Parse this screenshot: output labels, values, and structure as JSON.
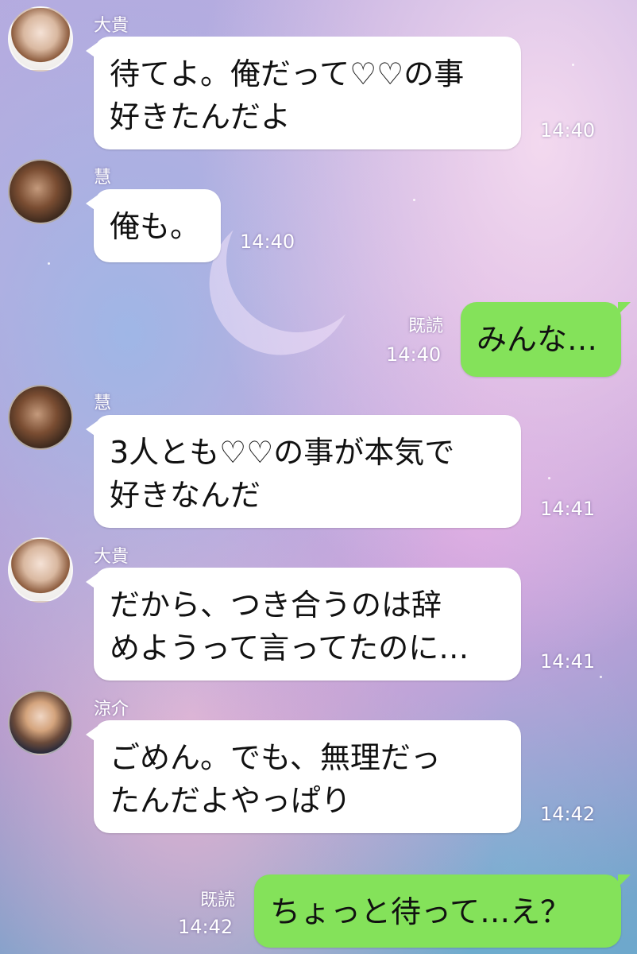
{
  "messages": [
    {
      "sender": "大貴",
      "text": "待てよ。俺だって♡♡の事\n好きたんだよ",
      "time": "14:40"
    },
    {
      "sender": "慧",
      "text": "俺も。",
      "time": "14:40"
    },
    {
      "read": "既読",
      "text": "みんな…",
      "time": "14:40"
    },
    {
      "sender": "慧",
      "text": "3人とも♡♡の事が本気で\n好きなんだ",
      "time": "14:41"
    },
    {
      "sender": "大貴",
      "text": "だから、つき合うのは辞\nめようって言ってたのに…",
      "time": "14:41"
    },
    {
      "sender": "涼介",
      "text": "ごめん。でも、無理だっ\nたんだよやっぱり",
      "time": "14:42"
    },
    {
      "read": "既読",
      "text": "ちょっと待って…え？",
      "time": "14:42"
    }
  ]
}
